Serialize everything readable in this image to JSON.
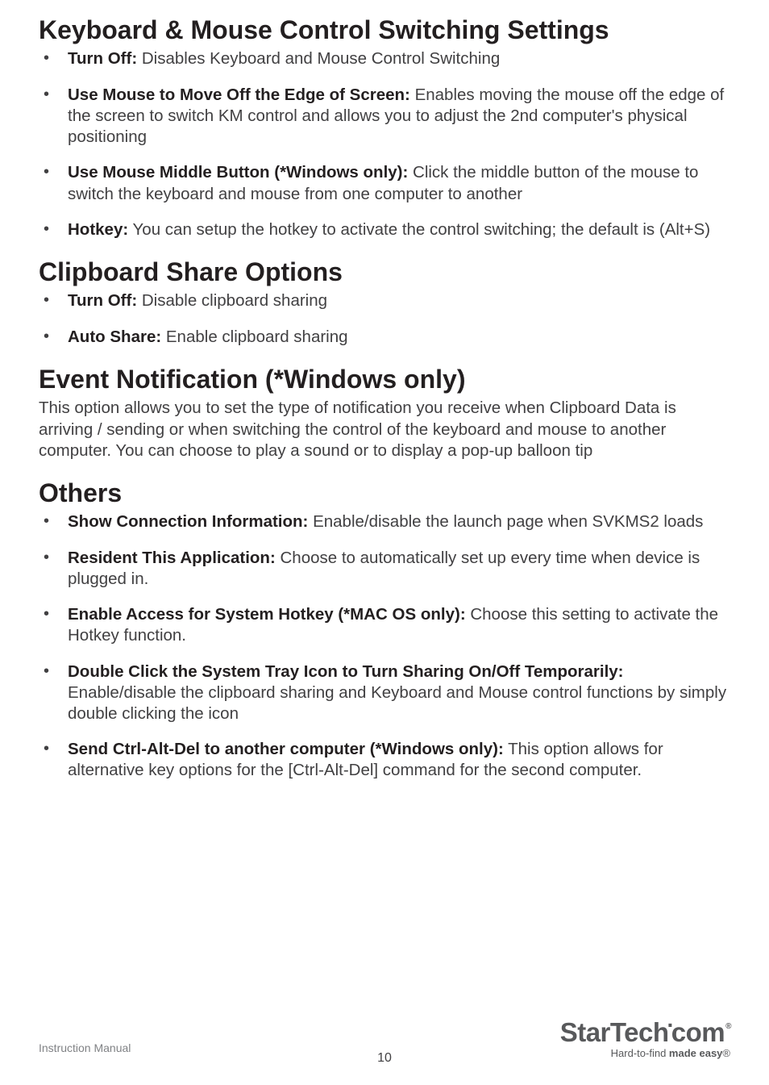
{
  "sections": {
    "km": {
      "heading": "Keyboard & Mouse Control Switching Settings",
      "items": [
        {
          "bold": "Turn Off:",
          "text": " Disables Keyboard and Mouse Control Switching"
        },
        {
          "bold": "Use Mouse to Move Off the Edge of Screen:",
          "text": " Enables moving the mouse off the edge of the screen to switch KM control and allows you to adjust the 2nd computer's physical positioning"
        },
        {
          "bold": "Use Mouse Middle Button (*Windows only):",
          "text": " Click the middle button of the mouse to switch the keyboard and mouse from one computer to another"
        },
        {
          "bold": "Hotkey:",
          "text": " You can setup the hotkey to activate the control switching; the default is (Alt+S)"
        }
      ]
    },
    "clip": {
      "heading": "Clipboard Share Options",
      "items": [
        {
          "bold": "Turn Off:",
          "text": " Disable clipboard sharing"
        },
        {
          "bold": "Auto Share:",
          "text": " Enable clipboard sharing"
        }
      ]
    },
    "event": {
      "heading": "Event Notification (*Windows only)",
      "para": "This option allows you to set the type of notification you receive when Clipboard Data is arriving / sending or when switching the control of the keyboard and mouse to another computer. You can choose to play a sound or to display a pop-up balloon tip"
    },
    "others": {
      "heading": "Others",
      "items": [
        {
          "bold": "Show Connection Information:",
          "text": " Enable/disable the launch page when SVKMS2 loads"
        },
        {
          "bold": "Resident This Application:",
          "text": " Choose to automatically set up every time when device is plugged in."
        },
        {
          "bold": "Enable Access for System Hotkey (*MAC OS only):",
          "text": " Choose this setting to activate the Hotkey function."
        },
        {
          "bold": "Double Click the System Tray Icon to Turn Sharing On/Off Temporarily:",
          "text": " Enable/disable the clipboard sharing and Keyboard and Mouse control functions by simply double clicking the icon"
        },
        {
          "bold": "Send Ctrl-Alt-Del to another computer (*Windows only):",
          "text": " This option allows for alternative key options for the [Ctrl-Alt-Del] command for the second computer."
        }
      ]
    }
  },
  "footer": {
    "label": "Instruction Manual",
    "page": "10"
  },
  "logo": {
    "part1": "StarTech",
    "part2": "com",
    "reg": "®",
    "tagline_pre": "Hard-to-find ",
    "tagline_bold": "made easy",
    "tagline_post": "®"
  }
}
